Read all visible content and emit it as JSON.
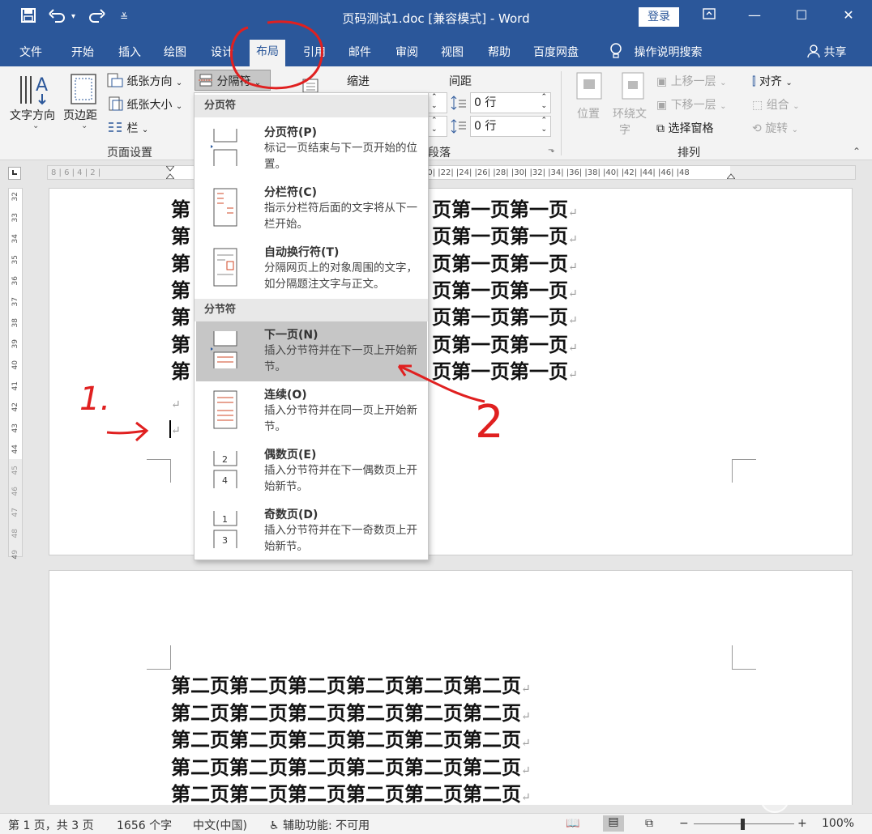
{
  "titlebar": {
    "title": "页码测试1.doc [兼容模式] - Word",
    "login_label": "登录",
    "save_icon": "save-icon",
    "undo_icon": "undo-icon",
    "redo_icon": "redo-icon"
  },
  "tabs": [
    {
      "label": "文件"
    },
    {
      "label": "开始"
    },
    {
      "label": "插入"
    },
    {
      "label": "绘图"
    },
    {
      "label": "设计"
    },
    {
      "label": "布局"
    },
    {
      "label": "引用"
    },
    {
      "label": "邮件"
    },
    {
      "label": "审阅"
    },
    {
      "label": "视图"
    },
    {
      "label": "帮助"
    },
    {
      "label": "百度网盘"
    }
  ],
  "active_tab": "布局",
  "tell_me": "操作说明搜索",
  "share": "共享",
  "ribbon": {
    "text_direction": "文字方向",
    "margins": "页边距",
    "orientation": "纸张方向",
    "size": "纸张大小",
    "columns": "栏",
    "breaks": "分隔符",
    "page_setup_group": "页面设置",
    "indent": "缩进",
    "spacing": "间距",
    "spacing_before": "0 行",
    "spacing_after": "0 行",
    "paragraph_group": "段落",
    "position": "位置",
    "wrap_text_1": "环绕文",
    "wrap_text_2": "字",
    "bring_forward": "上移一层",
    "send_backward": "下移一层",
    "selection_pane": "选择窗格",
    "align": "对齐",
    "group": "组合",
    "rotate": "旋转",
    "arrange_group": "排列"
  },
  "ruler": {
    "h_ticks": "8 | 6 | 4 | 2 |",
    "h_ticks_right": "20| |22| |24| |26| |28| |30| |32| |34| |36| |38| |40| |42| |44| |46| |48",
    "v_ticks": [
      "32",
      "33",
      "34",
      "35",
      "36",
      "37",
      "38",
      "39",
      "40",
      "41",
      "42",
      "43",
      "44",
      "45",
      "46",
      "47",
      "48",
      "49"
    ]
  },
  "dropdown": {
    "section1": "分页符",
    "section2": "分节符",
    "items": [
      {
        "title": "分页符(P)",
        "desc": "标记一页结束与下一页开始的位置。"
      },
      {
        "title": "分栏符(C)",
        "desc": "指示分栏符后面的文字将从下一栏开始。"
      },
      {
        "title": "自动换行符(T)",
        "desc": "分隔网页上的对象周围的文字，如分隔题注文字与正文。"
      },
      {
        "title": "下一页(N)",
        "desc": "插入分节符并在下一页上开始新节。"
      },
      {
        "title": "连续(O)",
        "desc": "插入分节符并在同一页上开始新节。"
      },
      {
        "title": "偶数页(E)",
        "desc": "插入分节符并在下一偶数页上开始新节。"
      },
      {
        "title": "奇数页(D)",
        "desc": "插入分节符并在下一奇数页上开始新节。"
      }
    ]
  },
  "page1": {
    "lead": "第",
    "tail": "页第一页第一页",
    "line_count": 7
  },
  "page2": {
    "line": "第二页第二页第二页第二页第二页第二页",
    "line_count": 5
  },
  "status": {
    "page": "第 1 页，共 3 页",
    "words": "1656 个字",
    "language": "中文(中国)",
    "accessibility": "辅助功能: 不可用",
    "zoom": "100%"
  },
  "annotations": {
    "step1": "1.",
    "step2": "2"
  },
  "colors": {
    "brand": "#2b579a",
    "ribbon_bg": "#f3f3f3",
    "annotation": "#e02020"
  }
}
